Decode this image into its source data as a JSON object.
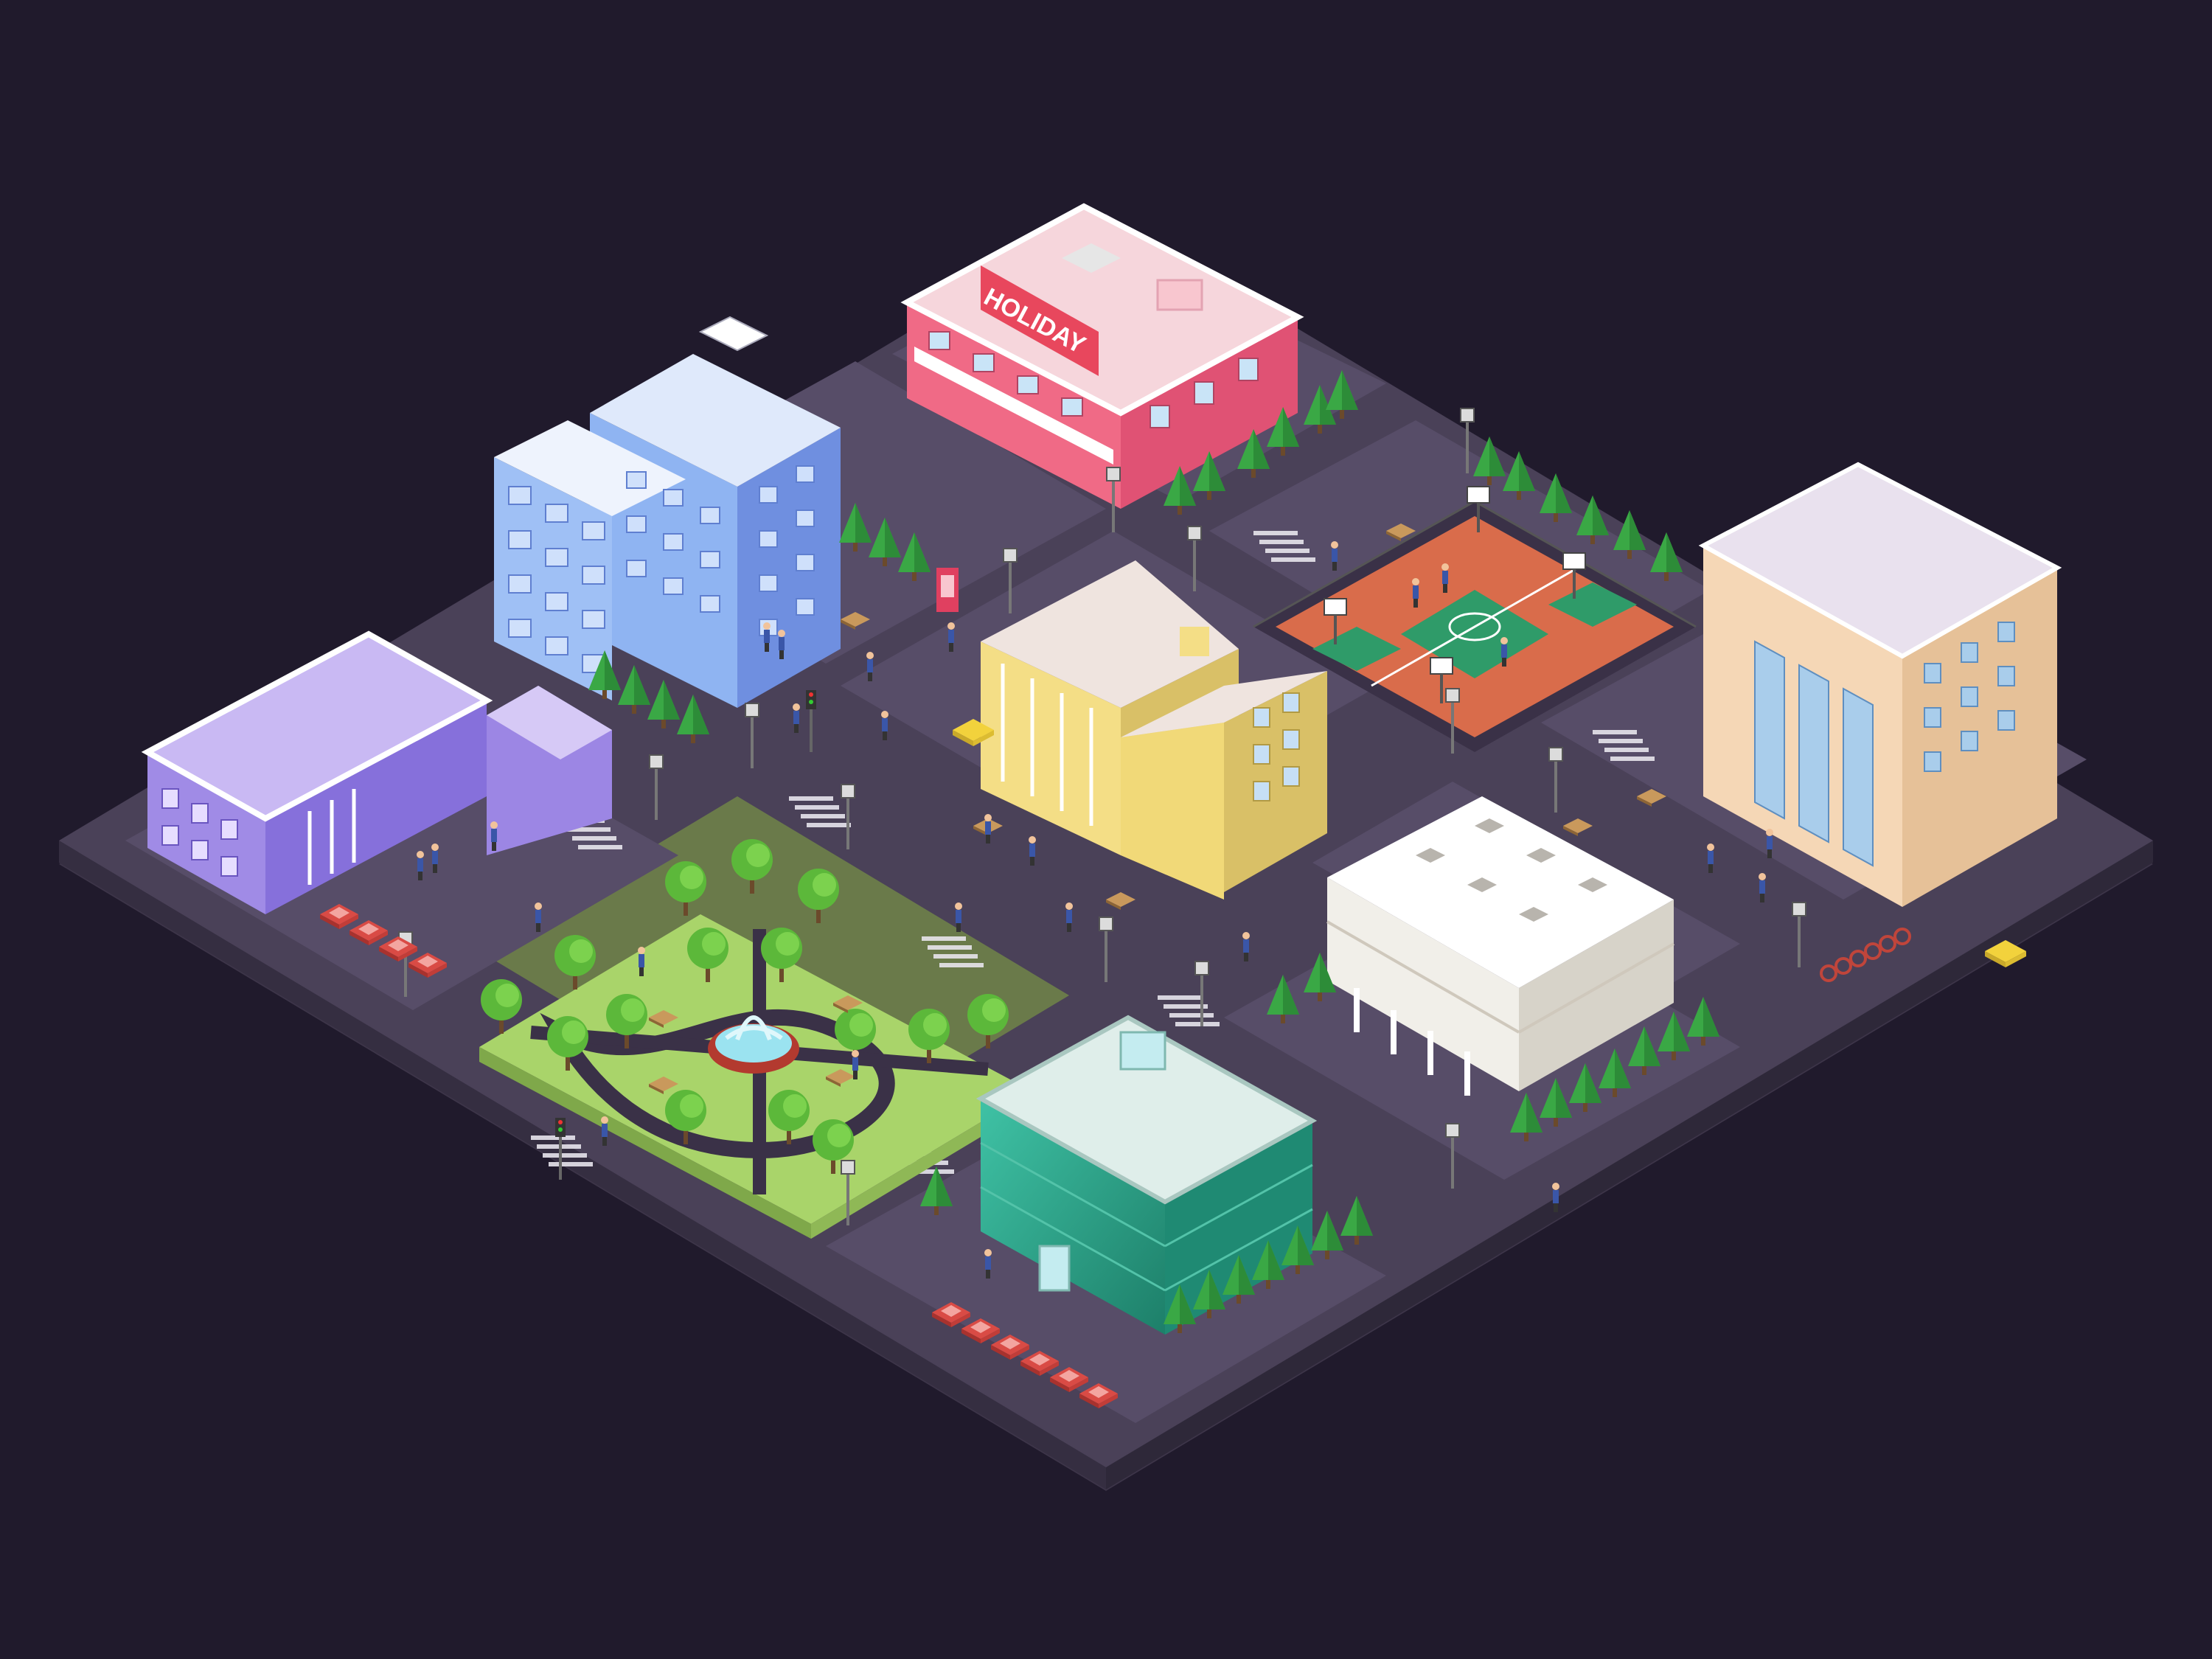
{
  "scene": {
    "background": "#201a2c",
    "platform_color": "#4a4158",
    "road_color": "#3a3147",
    "block_color": "#574d68"
  },
  "buildings": {
    "hotel_sign": "HOLIDAY",
    "hotel": {
      "wall": "#f06a86",
      "roof": "#f6d6dc",
      "trim": "#ffffff"
    },
    "blue_tower": {
      "wall": "#8fb4f2",
      "side": "#6f8fe0",
      "roof": "#dfe9fb"
    },
    "purple_building": {
      "wall": "#a08be6",
      "side": "#7d66d1",
      "roof": "#c9b9f3"
    },
    "yellow_building": {
      "wall": "#f4de86",
      "side": "#d9c067",
      "roof": "#efe4df"
    },
    "peach_tower": {
      "wall": "#f5d7b6",
      "side": "#e6c198",
      "roof": "#e9e1ee"
    },
    "white_building": {
      "wall": "#f1efe9",
      "side": "#d7d3c9",
      "roof": "#ffffff"
    },
    "green_glass": {
      "wall": "#2ea88e",
      "side": "#1f8a73",
      "roof": "#dfeeea"
    }
  },
  "park": {
    "grass": "#a9d46a",
    "path": "#3a3147",
    "fountain": "#9be3f0"
  },
  "court": {
    "surface": "#d96c4b",
    "inner": "#2f9b69"
  },
  "icons": [
    "tree-icon",
    "street-lamp-icon",
    "car-icon",
    "traffic-light-icon",
    "phone-booth-icon",
    "basketball-hoop-icon",
    "fountain-icon",
    "bench-icon",
    "person-icon",
    "bicycle-rack-icon"
  ]
}
